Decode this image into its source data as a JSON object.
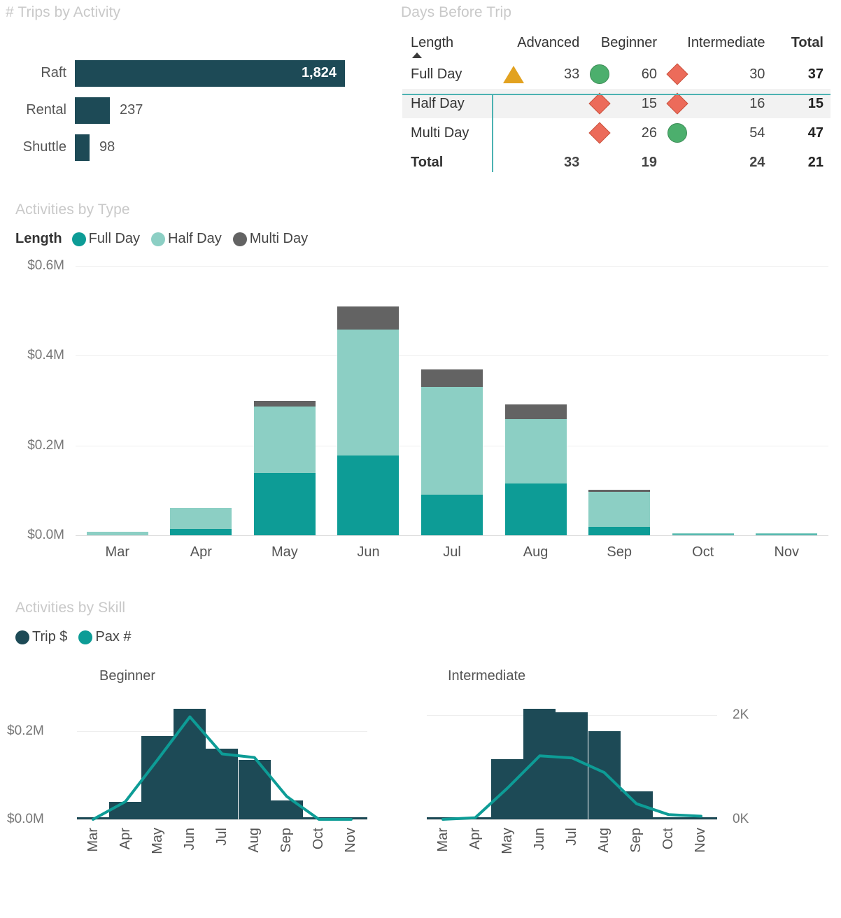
{
  "trips_panel": {
    "title": "# Trips by Activity",
    "rows": [
      {
        "label": "Raft",
        "value": "1,824",
        "num": 1824
      },
      {
        "label": "Rental",
        "value": "237",
        "num": 237
      },
      {
        "label": "Shuttle",
        "value": "98",
        "num": 98
      }
    ],
    "max": 1824,
    "bar_color": "#1d4a56"
  },
  "matrix_panel": {
    "title": "Days Before Trip",
    "columns": [
      "Length",
      "Advanced",
      "Beginner",
      "Intermediate",
      "Total"
    ],
    "sort_column": "Length",
    "sort_direction": "ascending",
    "rows": [
      {
        "length": "Full Day",
        "advanced_icon": "triangle",
        "advanced": "33",
        "beginner_icon": "circle",
        "beginner": "60",
        "intermediate_icon": "diamond",
        "intermediate": "30",
        "total": "37"
      },
      {
        "length": "Half Day",
        "advanced_icon": "",
        "advanced": "",
        "beginner_icon": "diamond",
        "beginner": "15",
        "intermediate_icon": "diamond",
        "intermediate": "16",
        "total": "15"
      },
      {
        "length": "Multi Day",
        "advanced_icon": "",
        "advanced": "",
        "beginner_icon": "diamond",
        "beginner": "26",
        "intermediate_icon": "circle",
        "intermediate": "54",
        "total": "47"
      }
    ],
    "total_row": {
      "length": "Total",
      "advanced": "33",
      "beginner": "19",
      "intermediate": "24",
      "total": "21"
    },
    "icon_colors": {
      "circle": "#4caf6d",
      "diamond": "#ec6b5a",
      "triangle": "#e2a220"
    },
    "rule_color": "#4cb2b2"
  },
  "type_panel": {
    "title": "Activities by Type",
    "legend_title": "Length"
  },
  "skill_panel": {
    "title": "Activities by Skill",
    "legend": [
      {
        "label": "Trip $",
        "color": "#1d4a56"
      },
      {
        "label": "Pax #",
        "color": "#0d9c96"
      }
    ],
    "charts": [
      {
        "title": "Beginner"
      },
      {
        "title": "Intermediate"
      }
    ]
  },
  "chart_data": [
    {
      "type": "bar",
      "title": "# Trips by Activity",
      "categories": [
        "Raft",
        "Rental",
        "Shuttle"
      ],
      "values": [
        1824,
        237,
        98
      ],
      "orientation": "horizontal",
      "xlabel": "",
      "ylabel": "",
      "data_labels": [
        "1,824",
        "237",
        "98"
      ]
    },
    {
      "type": "bar",
      "subtype": "stacked",
      "title": "Activities by Type",
      "categories": [
        "Mar",
        "Apr",
        "May",
        "Jun",
        "Jul",
        "Aug",
        "Sep",
        "Oct",
        "Nov"
      ],
      "series": [
        {
          "name": "Full Day",
          "color": "#0d9c96",
          "values": [
            0.0,
            0.014,
            0.139,
            0.178,
            0.09,
            0.116,
            0.018,
            0.002,
            0.002
          ]
        },
        {
          "name": "Half Day",
          "color": "#8ccfc4",
          "values": [
            0.008,
            0.047,
            0.148,
            0.28,
            0.24,
            0.143,
            0.078,
            0.002,
            0.002
          ]
        },
        {
          "name": "Multi Day",
          "color": "#636363",
          "values": [
            0.0,
            0.0,
            0.013,
            0.052,
            0.04,
            0.033,
            0.006,
            0.0,
            0.0
          ]
        }
      ],
      "ylabel": "",
      "xlabel": "",
      "ytick_labels": [
        "$0.0M",
        "$0.2M",
        "$0.4M",
        "$0.6M"
      ],
      "ylim": [
        0,
        0.6
      ],
      "grid": true,
      "legend_position": "top-left",
      "legend_title": "Length"
    },
    {
      "type": "bar",
      "subtype": "combo-bar-line",
      "title": "Beginner",
      "categories": [
        "Mar",
        "Apr",
        "May",
        "Jun",
        "Jul",
        "Aug",
        "Sep",
        "Oct",
        "Nov"
      ],
      "series": [
        {
          "name": "Trip $",
          "kind": "bar",
          "color": "#1d4a56",
          "values": [
            0.004,
            0.04,
            0.189,
            0.25,
            0.16,
            0.135,
            0.043,
            0.0,
            0.0
          ]
        },
        {
          "name": "Pax #",
          "kind": "line",
          "color": "#0d9c96",
          "values": [
            0.0,
            0.04,
            0.135,
            0.232,
            0.148,
            0.14,
            0.052,
            0.0,
            0.0
          ]
        }
      ],
      "ytick_labels": [
        "$0.0M",
        "$0.2M"
      ],
      "ylim": [
        0,
        0.28
      ],
      "grid": true
    },
    {
      "type": "bar",
      "subtype": "combo-bar-line",
      "title": "Intermediate",
      "categories": [
        "Mar",
        "Apr",
        "May",
        "Jun",
        "Jul",
        "Aug",
        "Sep",
        "Oct",
        "Nov"
      ],
      "series": [
        {
          "name": "Trip $",
          "kind": "bar",
          "color": "#1d4a56",
          "values": [
            0.01,
            0.012,
            1150,
            2130,
            2060,
            1700,
            540,
            0.01,
            0.01
          ]
        },
        {
          "name": "Pax #",
          "kind": "line",
          "color": "#0d9c96",
          "values": [
            0,
            30,
            600,
            1220,
            1180,
            900,
            300,
            90,
            60
          ]
        }
      ],
      "ytick_labels_right": [
        "0K",
        "2K"
      ],
      "ylim": [
        0,
        2400
      ],
      "grid": true
    }
  ]
}
